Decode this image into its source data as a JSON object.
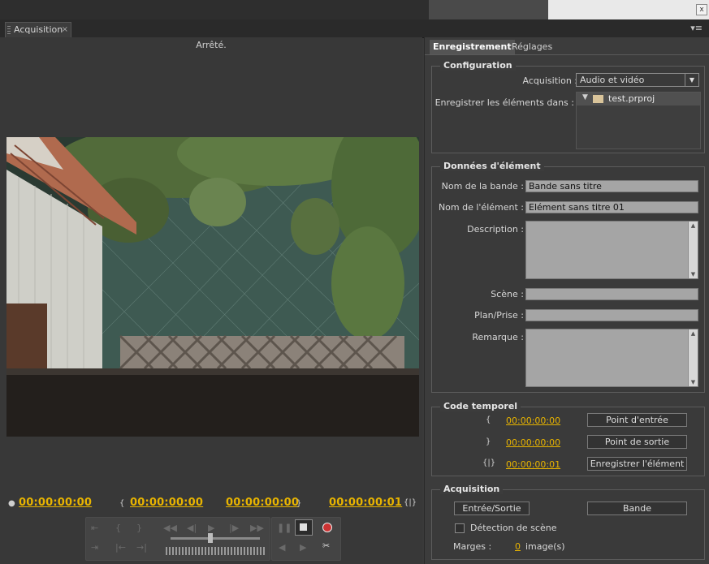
{
  "panel": {
    "tab_label": "Acquisition",
    "close_glyph": "×",
    "menu_glyph": "▾≡"
  },
  "window": {
    "close_glyph": "x"
  },
  "monitor": {
    "status": "Arrêté.",
    "timecode_current": "00:00:00:00",
    "timecode_in": "00:00:00:00",
    "timecode_out": "00:00:00:00",
    "timecode_duration": "00:00:00:01"
  },
  "tabs": {
    "recording": "Enregistrement",
    "settings": "Réglages"
  },
  "configuration": {
    "title": "Configuration",
    "acquisition_label": "Acquisition :",
    "acquisition_value": "Audio et vidéo",
    "save_label": "Enregistrer les éléments dans :",
    "project_item": "test.prproj"
  },
  "element_data": {
    "title": "Données d'élément",
    "tape_name_label": "Nom de la bande :",
    "tape_name_value": "Bande sans titre",
    "element_name_label": "Nom de l'élément :",
    "element_name_value": "Elément sans titre 01",
    "description_label": "Description :",
    "scene_label": "Scène :",
    "shot_label": "Plan/Prise :",
    "note_label": "Remarque :"
  },
  "timecode": {
    "title": "Code temporel",
    "in_value": "00:00:00:00",
    "out_value": "00:00:00:00",
    "duration_value": "00:00:00:01",
    "in_button": "Point d'entrée",
    "out_button": "Point de sortie",
    "log_button": "Enregistrer l'élément"
  },
  "capture": {
    "title": "Acquisition",
    "in_out_button": "Entrée/Sortie",
    "tape_button": "Bande",
    "scene_detect_label": "Détection de scène",
    "margins_label": "Marges :",
    "margins_value": "0",
    "margins_unit": "image(s)"
  }
}
